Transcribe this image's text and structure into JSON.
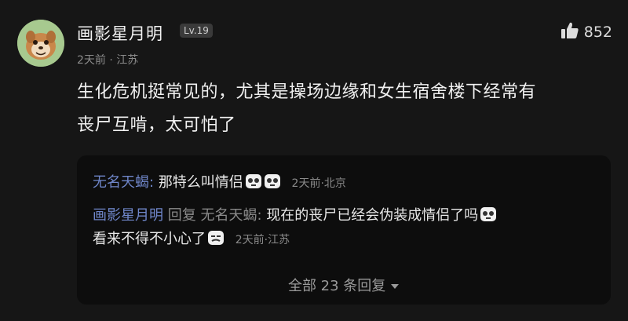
{
  "comment": {
    "username": "画影星月明",
    "level": "Lv.19",
    "likes": "852",
    "time": "2天前",
    "location": "江苏",
    "text_line1": "生化危机挺常见的，尤其是操场边缘和女生宿舍楼下经常有",
    "text_line2": "丧尸互啃，太可怕了"
  },
  "replies": [
    {
      "author": "无名天蝎",
      "sep": ":",
      "text": "那特么叫情侣",
      "time": "2天前",
      "location": "北京"
    },
    {
      "author": "画影星月明",
      "reply_word": "回复",
      "target": "无名天蝎",
      "sep": ":",
      "text1": "现在的丧尸已经会伪装成情侣了吗",
      "text2": "看来不得不小心了",
      "time": "2天前",
      "location": "江苏"
    }
  ],
  "expand_label": "全部 23 条回复",
  "dot": "·"
}
